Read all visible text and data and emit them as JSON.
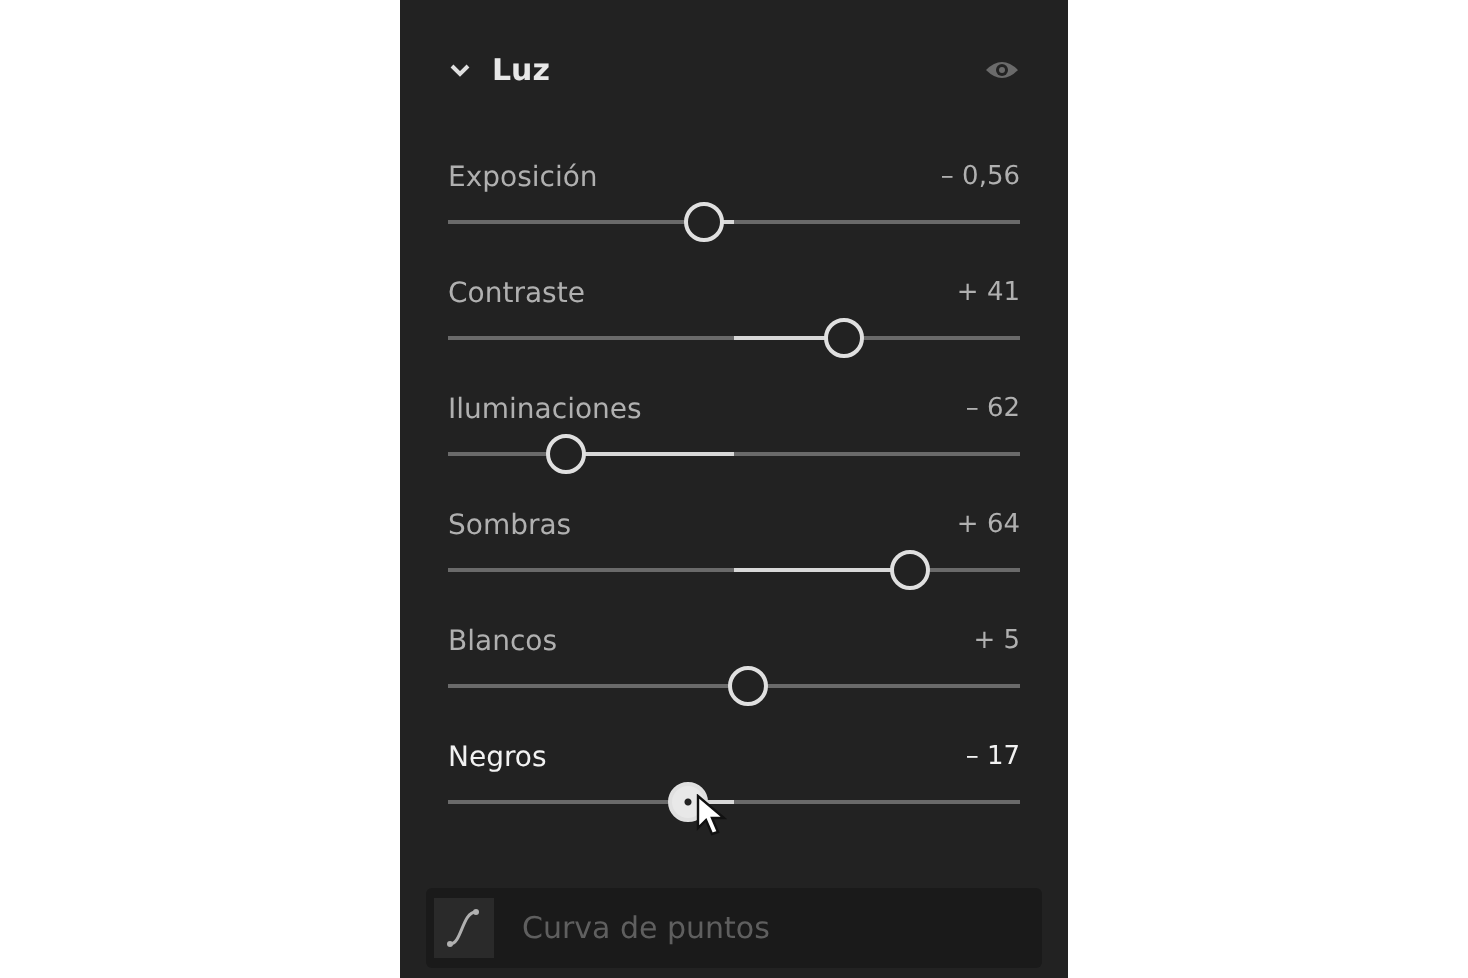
{
  "section": {
    "title": "Luz",
    "expanded": true
  },
  "sliders": [
    {
      "label": "Exposición",
      "value": "– 0,56",
      "level": 0.448,
      "active": false
    },
    {
      "label": "Contraste",
      "value": "+ 41",
      "level": 0.694,
      "active": false
    },
    {
      "label": "Iluminaciones",
      "value": "– 62",
      "level": 0.208,
      "active": false
    },
    {
      "label": "Sombras",
      "value": "+ 64",
      "level": 0.806,
      "active": false
    },
    {
      "label": "Blancos",
      "value": "+ 5",
      "level": 0.524,
      "active": false
    },
    {
      "label": "Negros",
      "value": "– 17",
      "level": 0.42,
      "active": true
    }
  ],
  "next_section": {
    "title": "Curva de puntos"
  }
}
